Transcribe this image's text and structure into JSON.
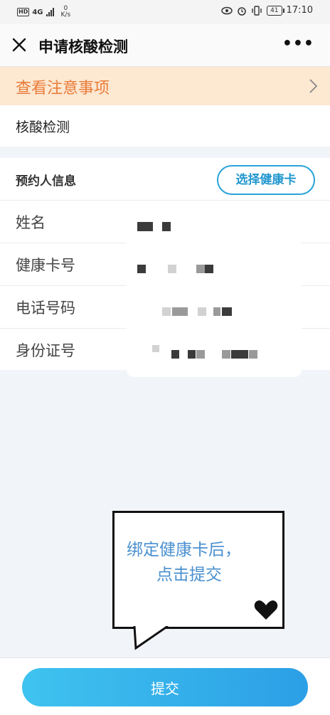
{
  "status_bar": {
    "hd": "HD",
    "network": "4G",
    "speed_value": "0",
    "speed_unit": "K/s",
    "battery": "41",
    "time": "17:10"
  },
  "nav": {
    "title": "申请核酸检测",
    "more": "•••"
  },
  "notice": {
    "text": "查看注意事项"
  },
  "test_type": {
    "label": "核酸检测"
  },
  "booker": {
    "title": "预约人信息",
    "select_button": "选择健康卡",
    "rows": [
      {
        "label": "姓名"
      },
      {
        "label": "健康卡号"
      },
      {
        "label": "电话号码"
      },
      {
        "label": "身份证号"
      }
    ]
  },
  "hint": {
    "line1": "绑定健康卡后，",
    "line2": "点击提交"
  },
  "submit": {
    "label": "提交"
  },
  "colors": {
    "notice_bg": "#fde8d2",
    "notice_text": "#e97c39",
    "accent": "#2aa3d8",
    "submit_gradient_start": "#3fc3ef",
    "submit_gradient_end": "#2c9fe6"
  }
}
